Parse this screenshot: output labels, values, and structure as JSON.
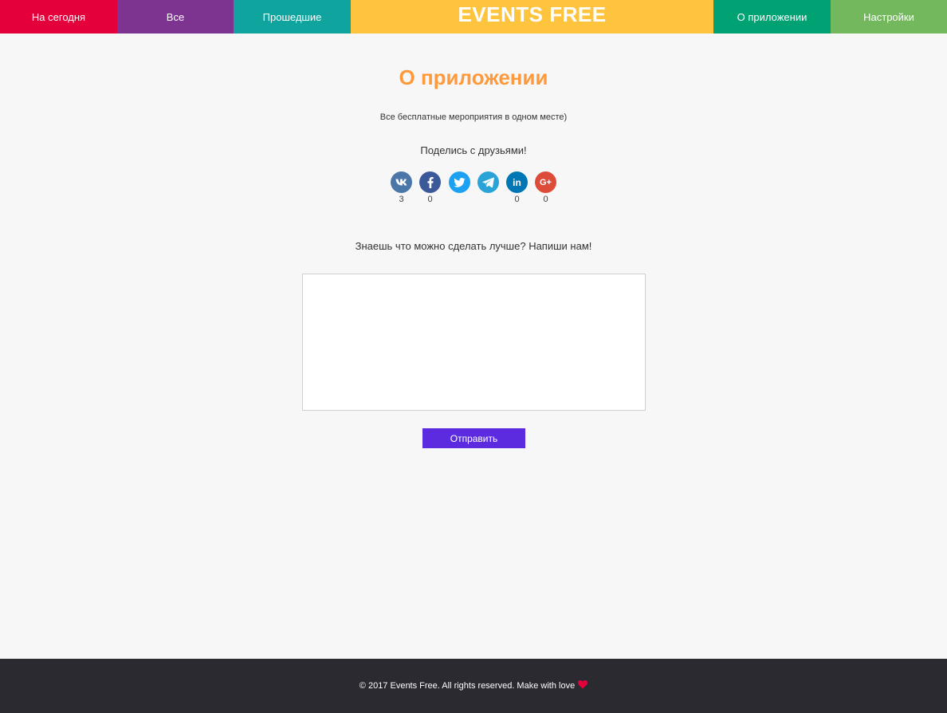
{
  "nav": {
    "today": "На сегодня",
    "all": "Все",
    "past": "Прошедшие",
    "brand": "EVENTS FREE",
    "about": "О приложении",
    "settings": "Настройки"
  },
  "colors": {
    "today": "#e4003a",
    "all": "#7d3491",
    "past": "#10a49e",
    "brand": "#ffc43d",
    "about": "#00a173",
    "settings": "#73b85c",
    "title": "#ff9a3c",
    "submit": "#5c2be0",
    "footer": "#2b2a31"
  },
  "page": {
    "title": "О приложении",
    "subtitle": "Все бесплатные мероприятия в одном месте)",
    "share_label": "Поделись с друзьями!",
    "feedback_label": "Знаешь что можно сделать лучше? Напиши нам!",
    "feedback_placeholder": "",
    "submit_label": "Отправить"
  },
  "share": [
    {
      "network": "vk",
      "icon": "vk-icon",
      "count": "3",
      "color": "#4a76a8"
    },
    {
      "network": "facebook",
      "icon": "facebook-icon",
      "count": "0",
      "color": "#3b5998"
    },
    {
      "network": "twitter",
      "icon": "twitter-icon",
      "count": "",
      "color": "#1da1f2"
    },
    {
      "network": "telegram",
      "icon": "telegram-icon",
      "count": "",
      "color": "#2aa3d8"
    },
    {
      "network": "linkedin",
      "icon": "linkedin-icon",
      "count": "0",
      "color": "#0077b5"
    },
    {
      "network": "googleplus",
      "icon": "google-plus-icon",
      "count": "0",
      "color": "#dd4b39"
    }
  ],
  "footer": {
    "text": "© 2017 Events Free. All rights reserved. Make with love",
    "heart_icon": "heart-icon"
  }
}
